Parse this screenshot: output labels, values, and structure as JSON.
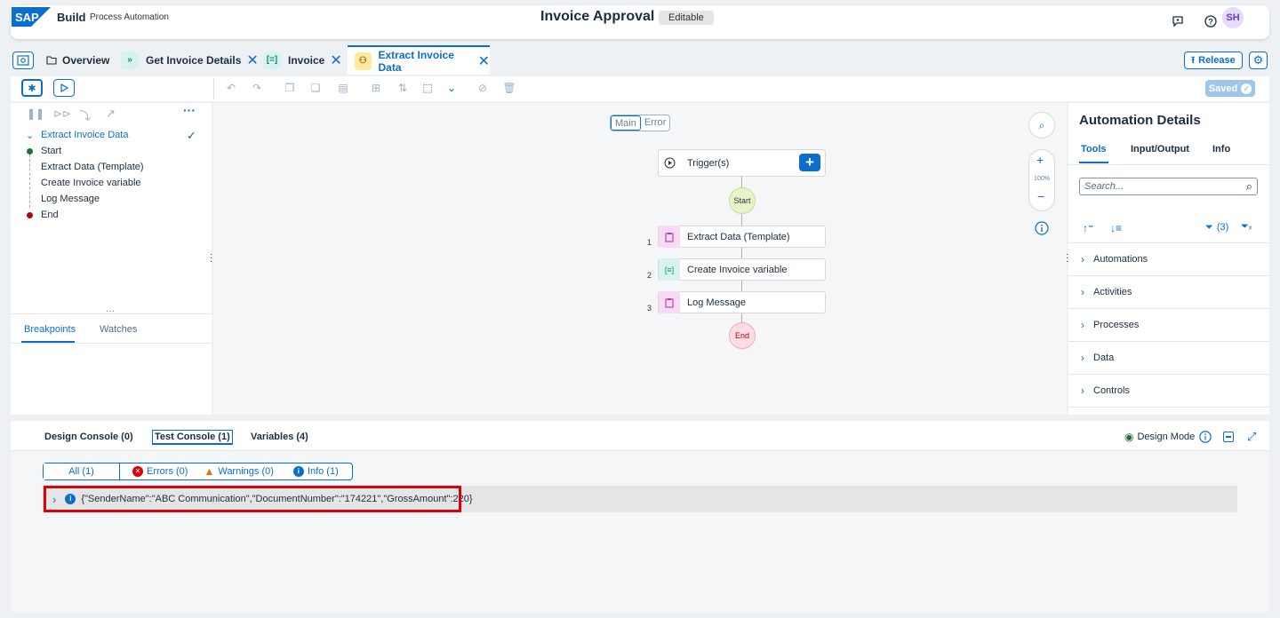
{
  "shell": {
    "logo": "SAP",
    "build": "Build",
    "product": "Process Automation",
    "title": "Invoice Approval",
    "editable": "Editable",
    "avatar": "SH"
  },
  "tabs": [
    {
      "label": "Overview"
    },
    {
      "label": "Get Invoice Details"
    },
    {
      "label": "Invoice"
    },
    {
      "label": "Extract Invoice Data"
    }
  ],
  "actions": {
    "release": "Release",
    "saved": "Saved"
  },
  "tree": {
    "root": "Extract Invoice Data",
    "items": [
      "Start",
      "Extract Data (Template)",
      "Create Invoice variable",
      "Log Message",
      "End"
    ]
  },
  "debug_tabs": {
    "breakpoints": "Breakpoints",
    "watches": "Watches"
  },
  "canvas": {
    "seg_main": "Main",
    "seg_error": "Error",
    "trigger": "Trigger(s)",
    "start": "Start",
    "end": "End",
    "zoom": "100%",
    "steps": [
      {
        "num": "1",
        "label": "Extract Data (Template)"
      },
      {
        "num": "2",
        "label": "Create Invoice variable"
      },
      {
        "num": "3",
        "label": "Log Message"
      }
    ]
  },
  "details": {
    "title": "Automation Details",
    "tabs": [
      "Tools",
      "Input/Output",
      "Info"
    ],
    "search_placeholder": "Search...",
    "filter_count": "(3)",
    "categories": [
      "Automations",
      "Activities",
      "Processes",
      "Data",
      "Controls"
    ]
  },
  "console": {
    "tabs": [
      "Design Console (0)",
      "Test Console (1)",
      "Variables (4)"
    ],
    "design_mode": "Design Mode",
    "filters": {
      "all": "All (1)",
      "errors": "Errors (0)",
      "warnings": "Warnings (0)",
      "info": "Info (1)"
    },
    "log": "{\"SenderName\":\"ABC Communication\",\"DocumentNumber\":\"174221\",\"GrossAmount\":220}"
  },
  "colors": {
    "accent": "#0a6ed1",
    "highlight": "#e0000a"
  }
}
